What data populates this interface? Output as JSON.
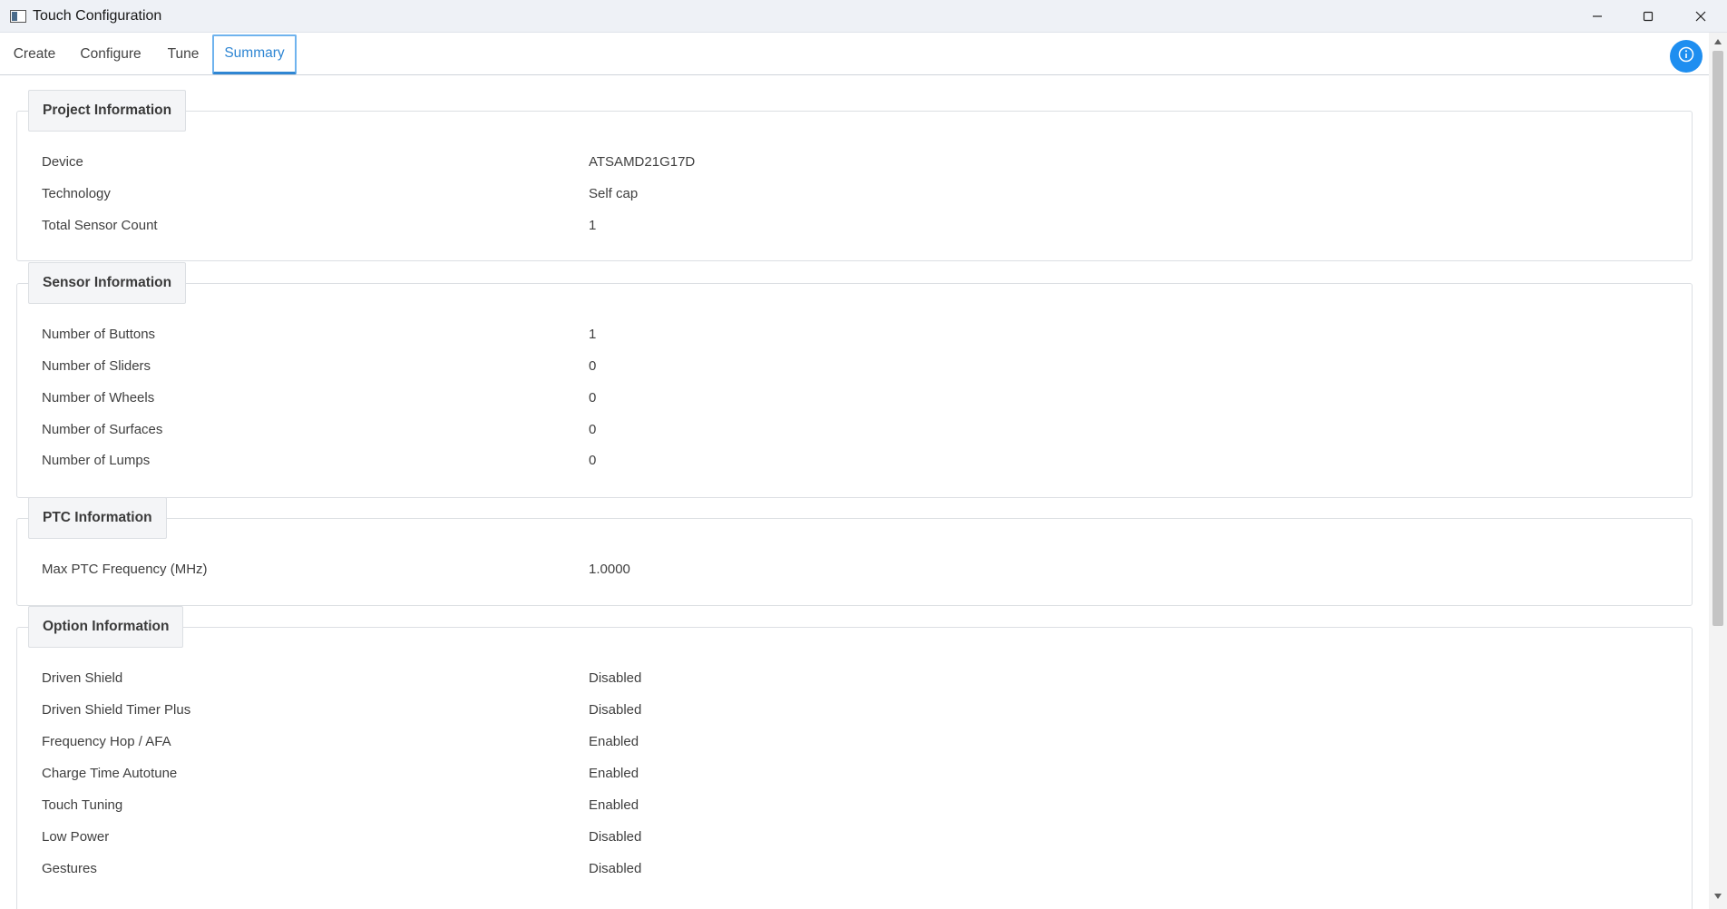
{
  "window": {
    "title": "Touch Configuration"
  },
  "tabs": [
    {
      "label": "Create"
    },
    {
      "label": "Configure"
    },
    {
      "label": "Tune"
    },
    {
      "label": "Summary",
      "active": true
    }
  ],
  "accent_color": "#2f86d3",
  "info_button_color": "#1e8ef0",
  "sections": {
    "project": {
      "title": "Project Information",
      "rows": [
        {
          "label": "Device",
          "value": "ATSAMD21G17D"
        },
        {
          "label": "Technology",
          "value": "Self cap"
        },
        {
          "label": "Total Sensor Count",
          "value": "1"
        }
      ]
    },
    "sensor": {
      "title": "Sensor Information",
      "rows": [
        {
          "label": "Number of Buttons",
          "value": "1"
        },
        {
          "label": "Number of Sliders",
          "value": "0"
        },
        {
          "label": "Number of Wheels",
          "value": "0"
        },
        {
          "label": "Number of Surfaces",
          "value": "0"
        },
        {
          "label": "Number of Lumps",
          "value": "0"
        }
      ]
    },
    "ptc": {
      "title": "PTC Information",
      "rows": [
        {
          "label": "Max PTC Frequency (MHz)",
          "value": "1.0000"
        }
      ]
    },
    "option": {
      "title": "Option Information",
      "rows": [
        {
          "label": "Driven Shield",
          "value": "Disabled"
        },
        {
          "label": "Driven Shield Timer Plus",
          "value": "Disabled"
        },
        {
          "label": "Frequency Hop / AFA",
          "value": "Enabled"
        },
        {
          "label": "Charge Time Autotune",
          "value": "Enabled"
        },
        {
          "label": "Touch Tuning",
          "value": "Enabled"
        },
        {
          "label": "Low Power",
          "value": "Disabled"
        },
        {
          "label": "Gestures",
          "value": "Disabled"
        }
      ]
    }
  }
}
